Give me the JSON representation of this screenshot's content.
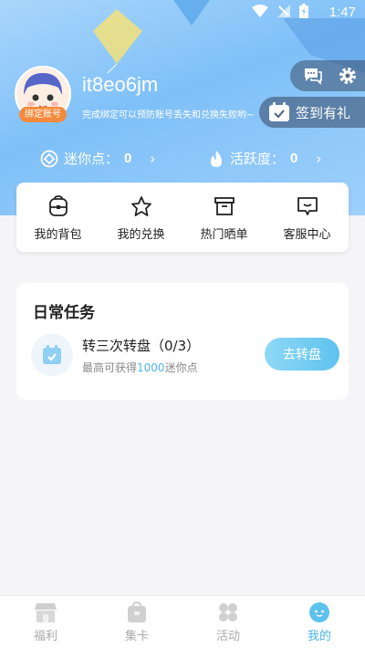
{
  "status_bar": {
    "time": "1:47"
  },
  "profile": {
    "username": "it8eo6jm",
    "bind_badge": "绑定账号",
    "bind_tip": "完成绑定可以预防账号丢失和兑换失败哟~"
  },
  "actions": {
    "signin_label": "签到有礼"
  },
  "stats": {
    "mini_points_label": "迷你点：",
    "mini_points_value": "0",
    "activity_label": "活跃度：",
    "activity_value": "0"
  },
  "quick_menu": [
    {
      "label": "我的背包",
      "icon": "backpack-icon"
    },
    {
      "label": "我的兑换",
      "icon": "star-icon"
    },
    {
      "label": "热门晒单",
      "icon": "box-icon"
    },
    {
      "label": "客服中心",
      "icon": "chat-icon"
    }
  ],
  "daily_tasks": {
    "title": "日常任务",
    "task": {
      "name": "转三次转盘（0/3）",
      "desc_prefix": "最高可获得",
      "desc_amount": "1000",
      "desc_suffix": "迷你点",
      "button": "去转盘"
    }
  },
  "tabs": [
    {
      "label": "福利",
      "icon": "shop-icon",
      "active": false
    },
    {
      "label": "集卡",
      "icon": "card-bag-icon",
      "active": false
    },
    {
      "label": "活动",
      "icon": "clover-icon",
      "active": false
    },
    {
      "label": "我的",
      "icon": "face-icon",
      "active": true
    }
  ],
  "colors": {
    "accent": "#47b4ea",
    "badge": "#f58a3c",
    "hero": "#8fc9f9"
  }
}
